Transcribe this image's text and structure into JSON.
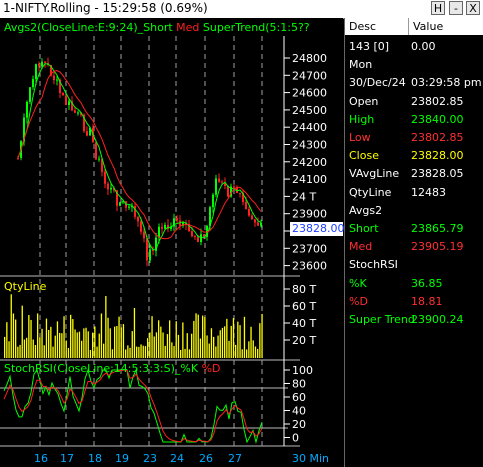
{
  "window": {
    "title": "1-NIFTY.Rolling - 15:29:58 (0.69%)",
    "btn_help": "H",
    "btn_min": "-",
    "btn_close": "X"
  },
  "price_chart": {
    "indicator_label_part1": "Avgs2(CloseLine:E:9:24)",
    "indicator_label_short": "Short",
    "indicator_label_med": "Med",
    "indicator_label_supertrend": "SuperTrend(5:1:5??",
    "axis_ticks": [
      "24800",
      "24700",
      "24600",
      "24500",
      "24400",
      "24300",
      "24200",
      "24100",
      "24 T",
      "23900",
      "23800",
      "23700",
      "23600"
    ],
    "last_price": "23828.00",
    "colors": {
      "up": "#00ff00",
      "down": "#ff2020",
      "short": "#00ff00",
      "med": "#ff2020",
      "grid": "#808080",
      "axis_text": "#ffffff"
    }
  },
  "volume_chart": {
    "label": "QtyLine",
    "axis_ticks": [
      "80 T",
      "60 T",
      "40 T",
      "20 T"
    ],
    "color": "#ffff00"
  },
  "stoch_chart": {
    "label_main": "StochRSI(CloseLine:14:5:3:3:S)",
    "label_k": "%K",
    "label_d": "%D",
    "axis_ticks": [
      "100",
      "80",
      "60",
      "40",
      "20",
      "0"
    ],
    "colors": {
      "k": "#00ff00",
      "d": "#ff2020"
    }
  },
  "x_axis": {
    "labels": [
      "16",
      "17",
      "18",
      "19",
      "23",
      "24",
      "26",
      "27"
    ],
    "timeframe": "30 Min"
  },
  "data_panel": {
    "header_desc": "Desc",
    "header_value": "Value",
    "rows": [
      {
        "desc": "143 [0]",
        "value": "0.00",
        "color": "#ffffff"
      },
      {
        "desc": "Mon",
        "value": "",
        "color": "#ffffff"
      },
      {
        "desc": "30/Dec/24",
        "value": "03:29:58 pm",
        "color": "#ffffff"
      },
      {
        "desc": "Open",
        "value": "23802.85",
        "color": "#ffffff"
      },
      {
        "desc": "High",
        "value": "23840.00",
        "color": "#00ff00"
      },
      {
        "desc": "Low",
        "value": "23802.85",
        "color": "#ff3030"
      },
      {
        "desc": "Close",
        "value": "23828.00",
        "color": "#ffff00"
      },
      {
        "desc": "VAvgLine",
        "value": "23828.05",
        "color": "#ffffff"
      },
      {
        "desc": "QtyLine",
        "value": "12483",
        "color": "#ffffff"
      },
      {
        "desc": "Avgs2",
        "value": "",
        "color": "#ffffff"
      },
      {
        "desc": " Short",
        "value": "23865.79",
        "color": "#00ff00"
      },
      {
        "desc": " Med",
        "value": "23905.19",
        "color": "#ff3030"
      },
      {
        "desc": "StochRSI",
        "value": "",
        "color": "#ffffff"
      },
      {
        "desc": "  %K",
        "value": "36.85",
        "color": "#00ff00"
      },
      {
        "desc": "  %D",
        "value": "18.81",
        "color": "#ff3030"
      },
      {
        "desc": "Super Trend",
        "value": "23900.24",
        "color": "#00ff00"
      }
    ]
  }
}
